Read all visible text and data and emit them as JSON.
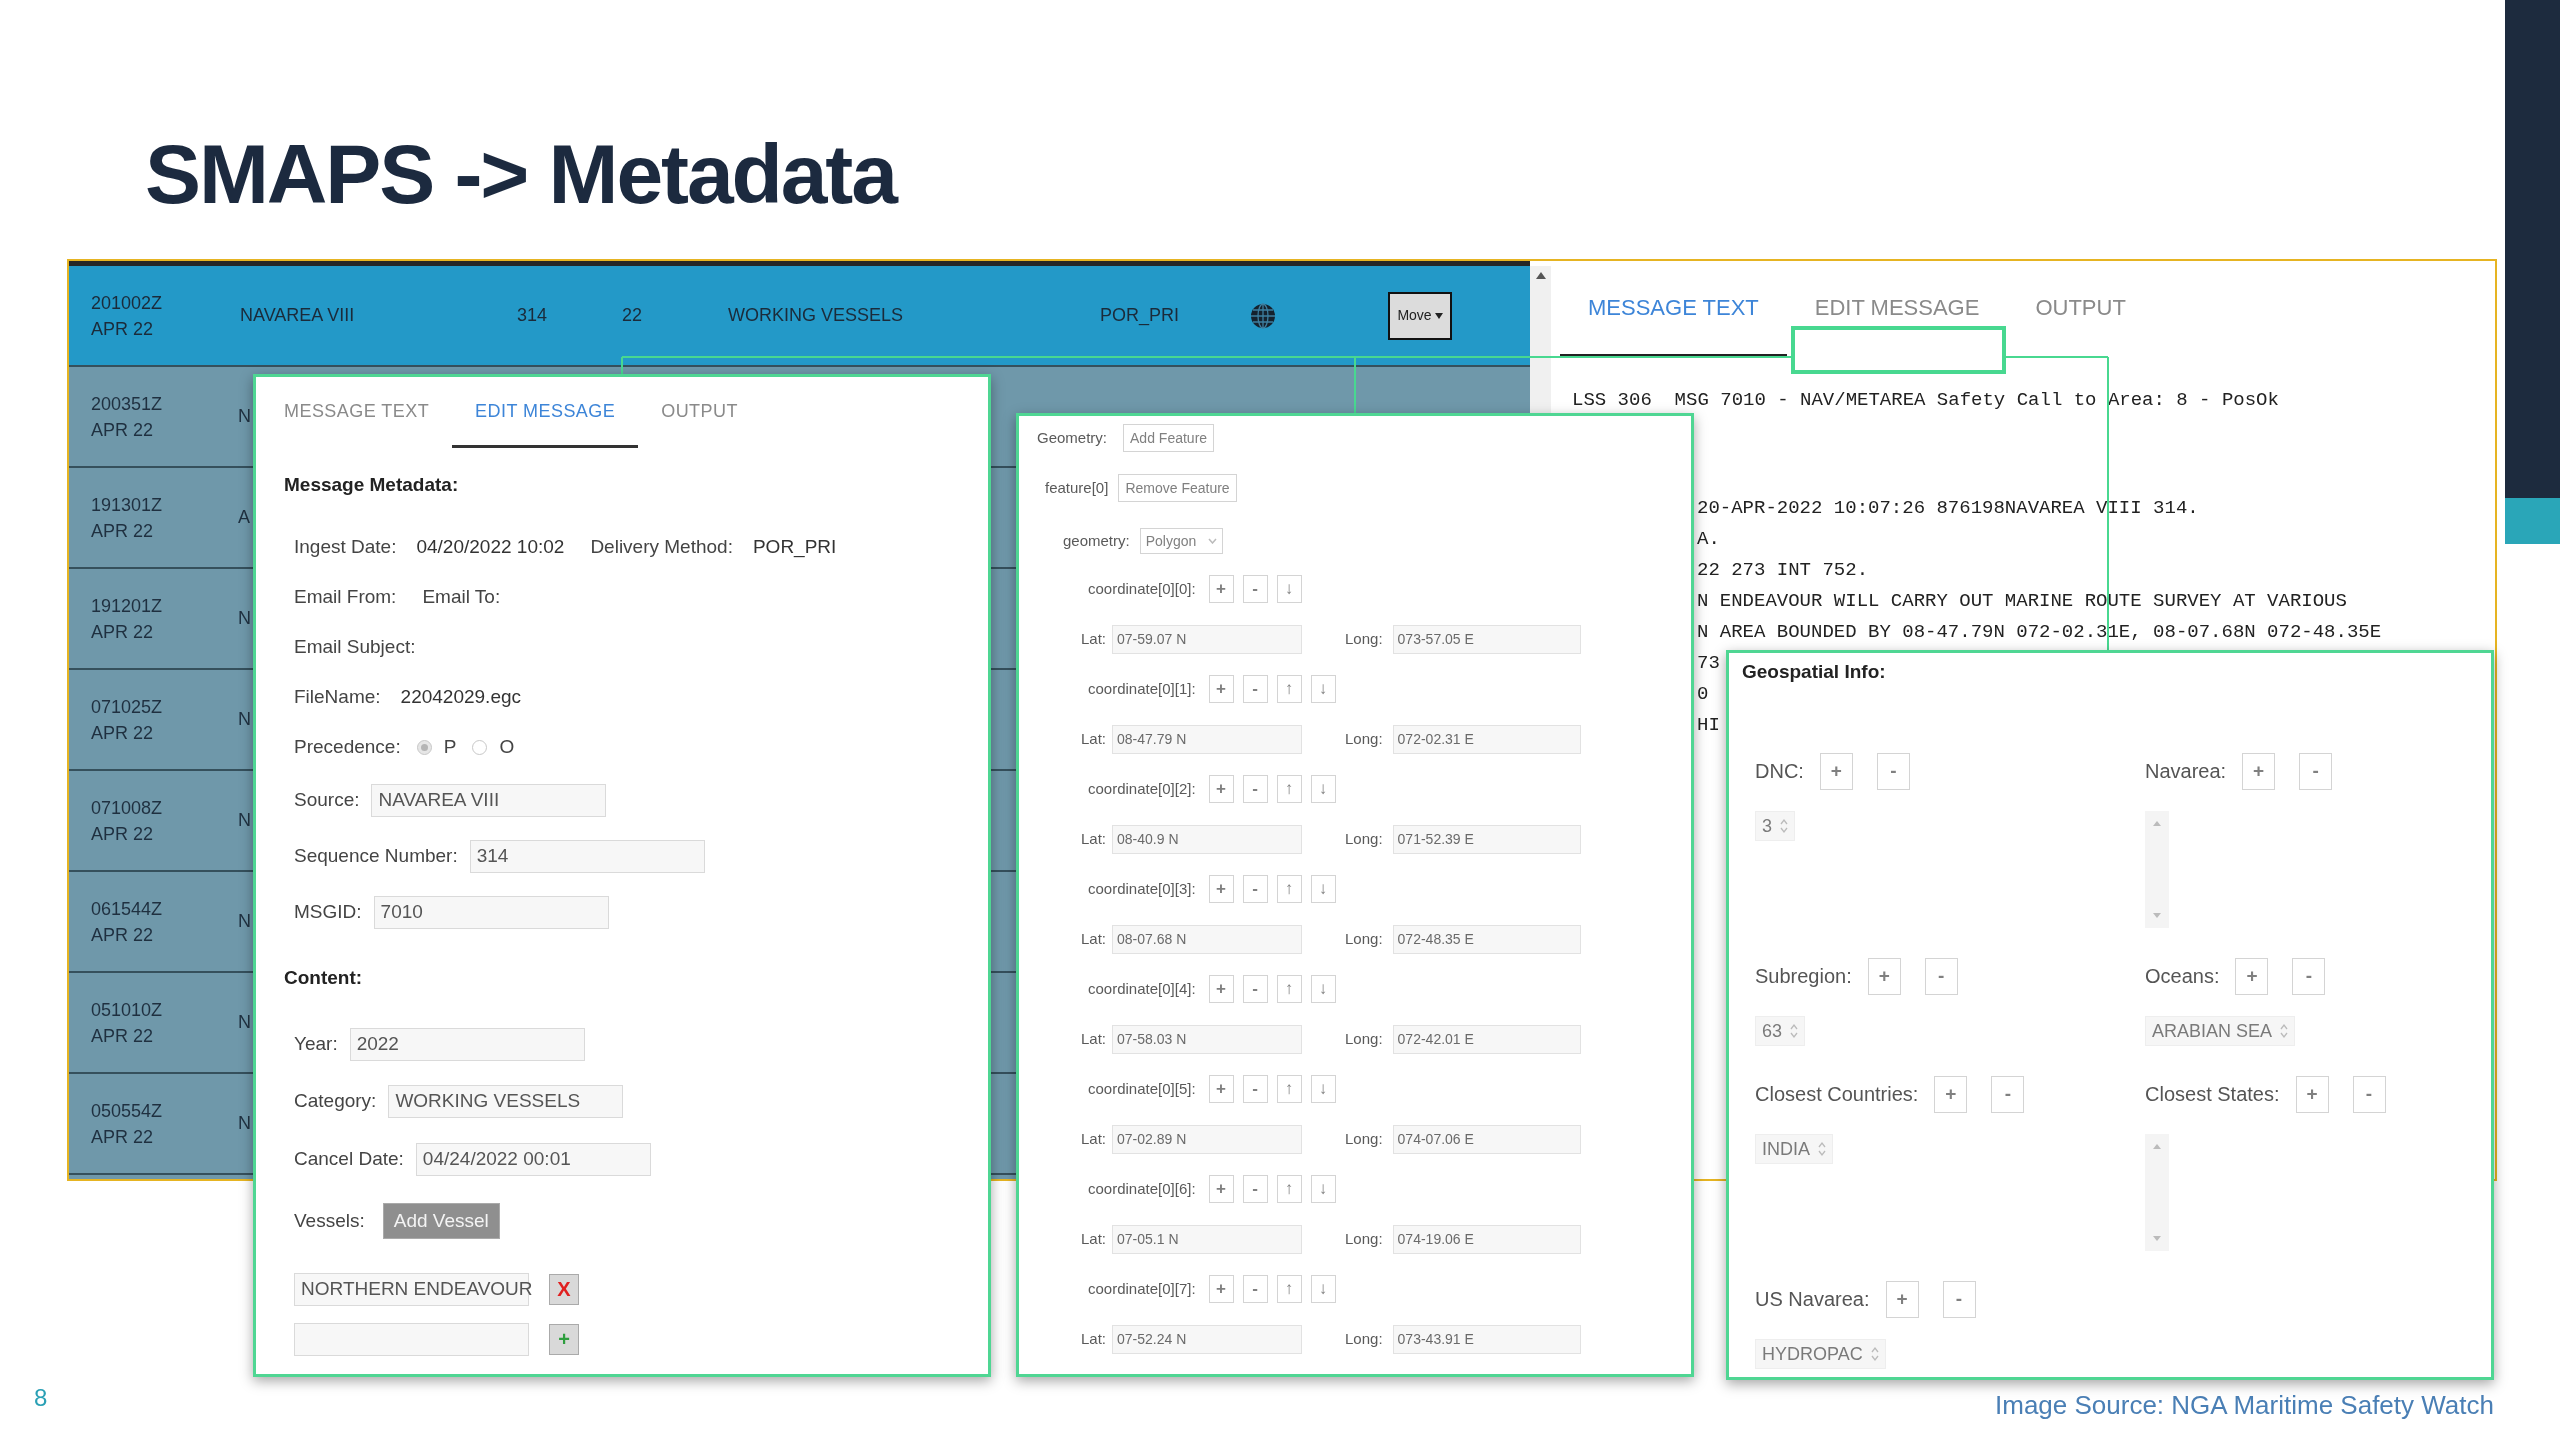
{
  "slide": {
    "title": "SMAPS -> Metadata",
    "page_number": "8",
    "source_note": "Image Source: NGA Maritime Safety Watch"
  },
  "message_list": {
    "rows": [
      {
        "selected": true,
        "time": "201002Z",
        "date": "APR 22",
        "area": "NAVAREA VIII",
        "number": "314",
        "year": "22",
        "category": "WORKING VESSELS",
        "delivery": "POR_PRI",
        "action": "Move"
      },
      {
        "selected": false,
        "time": "200351Z",
        "date": "APR 22",
        "column_2": "N"
      },
      {
        "selected": false,
        "time": "191301Z",
        "date": "APR 22",
        "column_2": "A"
      },
      {
        "selected": false,
        "time": "191201Z",
        "date": "APR 22",
        "column_2": "N"
      },
      {
        "selected": false,
        "time": "071025Z",
        "date": "APR 22",
        "column_2": "N"
      },
      {
        "selected": false,
        "time": "071008Z",
        "date": "APR 22",
        "column_2": "N"
      },
      {
        "selected": false,
        "time": "061544Z",
        "date": "APR 22",
        "column_2": "N"
      },
      {
        "selected": false,
        "time": "051010Z",
        "date": "APR 22",
        "column_2": "N"
      },
      {
        "selected": false,
        "time": "050554Z",
        "date": "APR 22",
        "column_2": "N"
      }
    ]
  },
  "message_panel": {
    "tabs": [
      {
        "label": "MESSAGE TEXT",
        "selected": true
      },
      {
        "label": "EDIT MESSAGE",
        "selected": false
      },
      {
        "label": "OUTPUT",
        "selected": false
      }
    ],
    "header_line": "LSS 306  MSG 7010 - NAV/METAREA Safety Call to Area: 8 - PosOk",
    "lines": [
      "20-APR-2022 10:07:26 876198NAVAREA VIII 314.",
      "A.",
      "22 273 INT 752.",
      "N ENDEAVOUR WILL CARRY OUT MARINE ROUTE SURVEY AT VARIOUS",
      "N AREA BOUNDED BY 08-47.79N 072-02.31E, 08-07.68N 072-48.35E",
      "73",
      "0",
      "HI"
    ]
  },
  "edit_panel": {
    "tabs": [
      {
        "label": "MESSAGE TEXT",
        "selected": false
      },
      {
        "label": "EDIT MESSAGE",
        "selected": true
      },
      {
        "label": "OUTPUT",
        "selected": false
      }
    ],
    "metadata": {
      "heading": "Message Metadata:",
      "rows": [
        {
          "kind": "pairs",
          "items": [
            {
              "label": "Ingest Date:",
              "value": "04/20/2022 10:02"
            },
            {
              "label": "Delivery Method:",
              "value": "POR_PRI"
            }
          ]
        },
        {
          "kind": "pairs",
          "items": [
            {
              "label": "Email From:"
            },
            {
              "label": "Email To:"
            }
          ]
        },
        {
          "kind": "pairs",
          "items": [
            {
              "label": "Email Subject:"
            }
          ]
        },
        {
          "kind": "pairs",
          "items": [
            {
              "label": "FileName:",
              "value": "22042029.egc"
            }
          ]
        },
        {
          "kind": "radio",
          "label": "Precedence:",
          "options": [
            {
              "label": "P",
              "selected": true
            },
            {
              "label": "O",
              "selected": false
            }
          ]
        },
        {
          "kind": "field",
          "label": "Source:",
          "value": "NAVAREA VIII"
        },
        {
          "kind": "field",
          "label": "Sequence Number:",
          "value": "314"
        },
        {
          "kind": "field",
          "label": "MSGID:",
          "value": "7010"
        }
      ]
    },
    "content": {
      "heading": "Content:",
      "rows": [
        {
          "kind": "field",
          "label": "Year:",
          "value": "2022"
        },
        {
          "kind": "field",
          "label": "Category:",
          "value": "WORKING VESSELS"
        },
        {
          "kind": "field",
          "label": "Cancel Date:",
          "value": "04/24/2022 00:01"
        },
        {
          "kind": "button",
          "label": "Vessels:",
          "button": "Add Vessel",
          "disabled": true
        }
      ]
    },
    "vessels": [
      {
        "kind": "remove",
        "value": "NORTHERN ENDEAVOUR",
        "action": "X"
      },
      {
        "kind": "add",
        "action": "+"
      }
    ]
  },
  "geometry_panel": {
    "disabled": true,
    "label": "Geometry:",
    "add_button": "Add Feature",
    "feature": {
      "label": "feature[0]",
      "remove_button": "Remove Feature",
      "geometry_label": "geometry:",
      "geometry_value": "Polygon"
    },
    "coordinates": [
      {
        "label": "coordinate[0][0]:",
        "buttons": [
          "+",
          "-",
          "↓"
        ],
        "lat_label": "Lat:",
        "lat": "07-59.07 N",
        "long_label": "Long:",
        "long": "073-57.05 E"
      },
      {
        "label": "coordinate[0][1]:",
        "buttons": [
          "+",
          "-",
          "↑",
          "↓"
        ],
        "lat_label": "Lat:",
        "lat": "08-47.79 N",
        "long_label": "Long:",
        "long": "072-02.31 E"
      },
      {
        "label": "coordinate[0][2]:",
        "buttons": [
          "+",
          "-",
          "↑",
          "↓"
        ],
        "lat_label": "Lat:",
        "lat": "08-40.9 N",
        "long_label": "Long:",
        "long": "071-52.39 E"
      },
      {
        "label": "coordinate[0][3]:",
        "buttons": [
          "+",
          "-",
          "↑",
          "↓"
        ],
        "lat_label": "Lat:",
        "lat": "08-07.68 N",
        "long_label": "Long:",
        "long": "072-48.35 E"
      },
      {
        "label": "coordinate[0][4]:",
        "buttons": [
          "+",
          "-",
          "↑",
          "↓"
        ],
        "lat_label": "Lat:",
        "lat": "07-58.03 N",
        "long_label": "Long:",
        "long": "072-42.01 E"
      },
      {
        "label": "coordinate[0][5]:",
        "buttons": [
          "+",
          "-",
          "↑",
          "↓"
        ],
        "lat_label": "Lat:",
        "lat": "07-02.89 N",
        "long_label": "Long:",
        "long": "074-07.06 E"
      },
      {
        "label": "coordinate[0][6]:",
        "buttons": [
          "+",
          "-",
          "↑",
          "↓"
        ],
        "lat_label": "Lat:",
        "lat": "07-05.1 N",
        "long_label": "Long:",
        "long": "074-19.06 E"
      },
      {
        "label": "coordinate[0][7]:",
        "buttons": [
          "+",
          "-",
          "↑",
          "↓"
        ],
        "lat_label": "Lat:",
        "lat": "07-52.24 N",
        "long_label": "Long:",
        "long": "073-43.91 E"
      }
    ]
  },
  "geospatial_panel": {
    "disabled": true,
    "heading": "Geospatial Info:",
    "groups": [
      {
        "label": "DNC:",
        "buttons": [
          "+",
          "-"
        ],
        "kind": "spinner",
        "value": "3"
      },
      {
        "label": "Navarea:",
        "buttons": [
          "+",
          "-"
        ],
        "kind": "listbox"
      },
      {
        "label": "Subregion:",
        "buttons": [
          "+",
          "-"
        ],
        "kind": "spinner",
        "value": "63"
      },
      {
        "label": "Oceans:",
        "buttons": [
          "+",
          "-"
        ],
        "kind": "spinner",
        "value": "ARABIAN SEA"
      },
      {
        "label": "Closest Countries:",
        "buttons": [
          "+",
          "-"
        ],
        "kind": "spinner",
        "value": "INDIA"
      },
      {
        "label": "Closest States:",
        "buttons": [
          "+",
          "-"
        ],
        "kind": "listbox"
      },
      {
        "label": "US Navarea:",
        "buttons": [
          "+",
          "-"
        ],
        "kind": "spinner",
        "value": "HYDROPAC"
      }
    ]
  }
}
